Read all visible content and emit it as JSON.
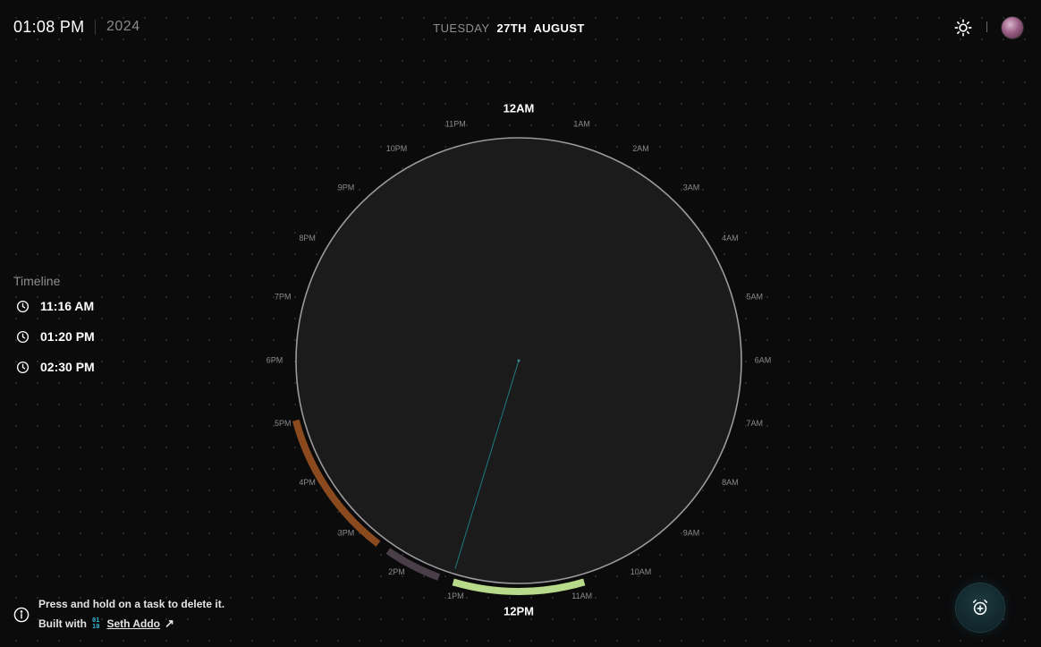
{
  "header": {
    "time": "01:08 PM",
    "year": "2024",
    "day_of_week": "TUESDAY",
    "date": "27TH  AUGUST",
    "theme_icon": "sun-icon",
    "avatar_icon": "user-avatar"
  },
  "timeline": {
    "title": "Timeline",
    "items": [
      {
        "label": "11:16 AM",
        "icon": "clock-icon"
      },
      {
        "label": "01:20 PM",
        "icon": "clock-icon"
      },
      {
        "label": "02:30 PM",
        "icon": "clock-icon"
      }
    ]
  },
  "dial": {
    "hour_labels": [
      "12AM",
      "1AM",
      "2AM",
      "3AM",
      "4AM",
      "5AM",
      "6AM",
      "7AM",
      "8AM",
      "9AM",
      "10AM",
      "11AM",
      "12PM",
      "1PM",
      "2PM",
      "3PM",
      "4PM",
      "5PM",
      "6PM",
      "7PM",
      "8PM",
      "9PM",
      "10PM",
      "11PM"
    ],
    "current_hour": 13.133,
    "tasks": [
      {
        "start_hour": 10.9,
        "end_hour": 13.1,
        "color": "#b7db8a"
      },
      {
        "start_hour": 13.35,
        "end_hour": 14.3,
        "color": "#4a3e48"
      },
      {
        "start_hour": 14.5,
        "end_hour": 17.0,
        "color": "#8a4a1e"
      }
    ],
    "hand_color": "#1f7a80",
    "face_color": "#1b1b1c",
    "ring_color": "#9a9a9e"
  },
  "footer": {
    "hint": "Press and hold on a task to delete it.",
    "built_with": "Built with",
    "logo_top": "01",
    "logo_bottom": "10",
    "author": "Seth Addo",
    "arrow": "↗",
    "info_icon": "info-icon"
  },
  "fab": {
    "icon": "alarm-add-icon"
  }
}
